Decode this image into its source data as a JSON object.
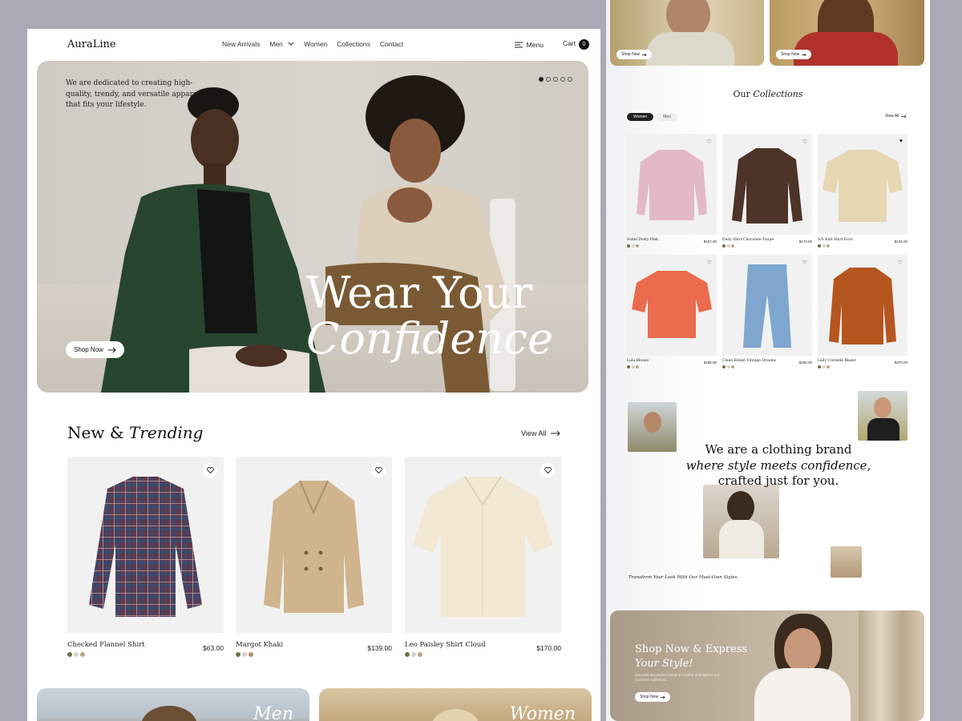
{
  "brand": "AuraLine",
  "nav": {
    "links": [
      "New Arrivals",
      "Men",
      "Women",
      "Collections",
      "Contact"
    ],
    "menu_label": "Menu",
    "cart_label": "Cart",
    "cart_count": "0"
  },
  "hero": {
    "intro": "We are dedicated to creating high-quality, trendy, and versatile apparel that fits your lifestyle.",
    "title_line1": "Wear Your",
    "title_line2": "Confidence",
    "cta": "Shop Now",
    "slides": 5,
    "active_slide": 1
  },
  "trending": {
    "title": "New &",
    "title_italic": "Trending",
    "view_all": "View All",
    "products": [
      {
        "name": "Checked Flannel Shirt",
        "price": "$63.00",
        "swatches": [
          "#6d7148",
          "#d8d3c6",
          "#b7a98a"
        ]
      },
      {
        "name": "Margot Khaki",
        "price": "$139.00",
        "swatches": [
          "#6d7148",
          "#d8d3c6",
          "#b18e6c"
        ]
      },
      {
        "name": "Leo Paisley Shirt Cloud",
        "price": "$170.00",
        "swatches": [
          "#6d7148",
          "#d8d3c6",
          "#b7a98a"
        ]
      }
    ]
  },
  "categories": [
    {
      "label": "Men"
    },
    {
      "label": "Women"
    }
  ],
  "right": {
    "shop_now": "Shop Now",
    "collections_title": "Our",
    "collections_title_italic": "Collections",
    "tabs": [
      "Women",
      "Men"
    ],
    "view_all": "View All",
    "products": [
      {
        "name": "Sonel Dusty Pink",
        "price": "$107.00",
        "color": "#e3b9c6"
      },
      {
        "name": "Daily Shirt Chocolate Taupe",
        "price": "$170.00",
        "color": "#4e3328"
      },
      {
        "name": "S/S Knit Shirt Ecru",
        "price": "$126.00",
        "color": "#e6d6b2"
      },
      {
        "name": "Lulu Blouse",
        "price": "$185.00",
        "color": "#ea6b4d"
      },
      {
        "name": "Clean Eileen Vintage Dreams",
        "price": "$200.00",
        "color": "#7ea6cf"
      },
      {
        "name": "Lady Cornelle Blazer",
        "price": "$270.00",
        "color": "#b5561f"
      }
    ],
    "brand_line1": "We are a clothing brand",
    "brand_line2": "where style meets confidence,",
    "brand_line3": "crafted just for you.",
    "tagline": "Transform Your Look With Our Must-Own Styles.",
    "promo_title": "Shop Now & Express",
    "promo_title_italic": "Your Style!",
    "promo_text": "Discover the perfect blend of comfort and style in our exclusive collection.",
    "promo_cta": "Shop Now"
  }
}
